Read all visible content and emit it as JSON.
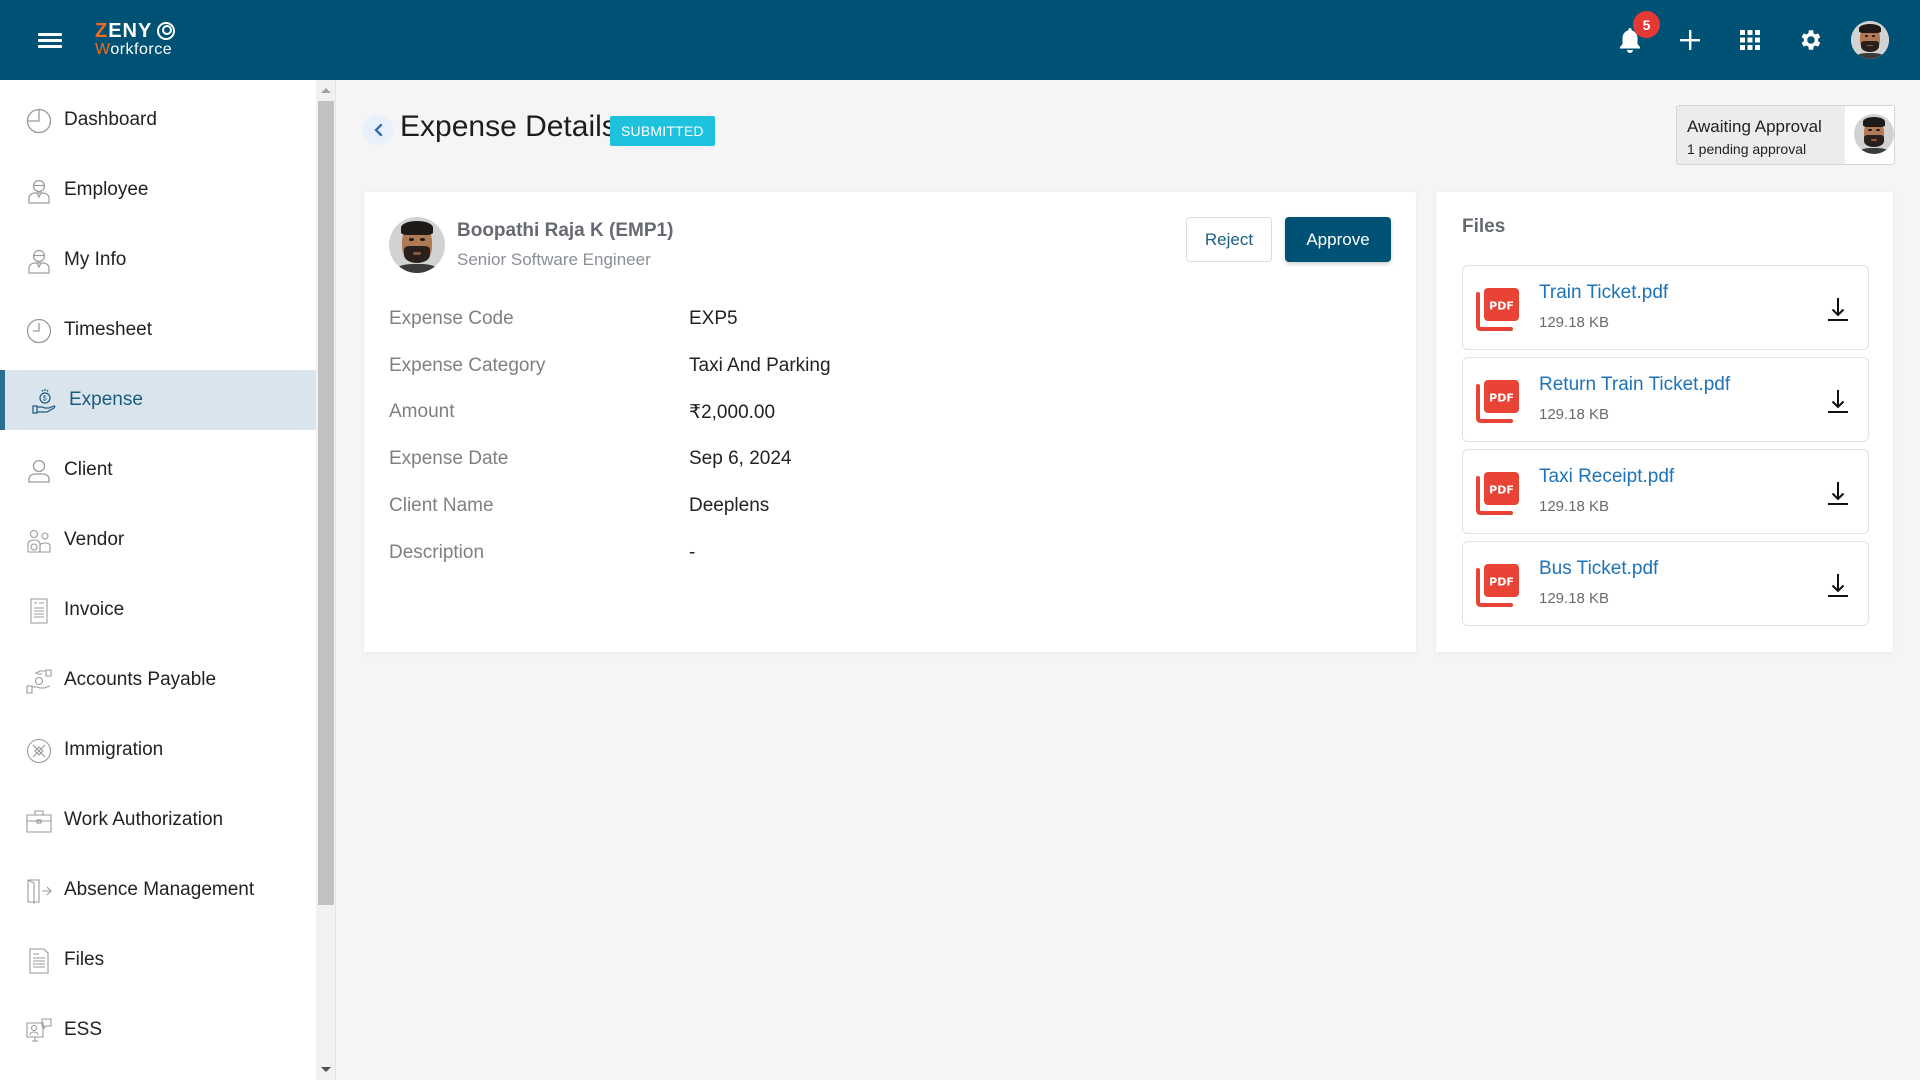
{
  "header": {
    "logo_line1_accent": "Z",
    "logo_line1_rest": "ENY",
    "logo_line2_accent": "W",
    "logo_line2_rest": "orkforce",
    "notification_count": "5",
    "icons": [
      "menu-icon",
      "bell-icon",
      "plus-icon",
      "apps-grid-icon",
      "gear-icon",
      "user-avatar"
    ]
  },
  "sidebar": {
    "items": [
      {
        "label": "Dashboard",
        "icon": "dashboard-pie-icon",
        "active": false
      },
      {
        "label": "Employee",
        "icon": "employee-icon",
        "active": false
      },
      {
        "label": "My Info",
        "icon": "my-info-icon",
        "active": false
      },
      {
        "label": "Timesheet",
        "icon": "clock-icon",
        "active": false
      },
      {
        "label": "Expense",
        "icon": "money-hand-icon",
        "active": true
      },
      {
        "label": "Client",
        "icon": "client-user-icon",
        "active": false
      },
      {
        "label": "Vendor",
        "icon": "vendor-icon",
        "active": false
      },
      {
        "label": "Invoice",
        "icon": "invoice-icon",
        "active": false
      },
      {
        "label": "Accounts Payable",
        "icon": "accounts-payable-icon",
        "active": false
      },
      {
        "label": "Immigration",
        "icon": "plane-icon",
        "active": false
      },
      {
        "label": "Work Authorization",
        "icon": "briefcase-icon",
        "active": false
      },
      {
        "label": "Absence Management",
        "icon": "door-exit-icon",
        "active": false
      },
      {
        "label": "Files",
        "icon": "document-icon",
        "active": false
      },
      {
        "label": "ESS",
        "icon": "monitor-chat-icon",
        "active": false
      }
    ]
  },
  "page": {
    "title": "Expense Details",
    "status": "SUBMITTED",
    "awaiting": {
      "title": "Awaiting Approval",
      "subtitle": "1 pending approval"
    }
  },
  "employee": {
    "name": "Boopathi Raja K (EMP1)",
    "role": "Senior Software Engineer"
  },
  "actions": {
    "reject": "Reject",
    "approve": "Approve"
  },
  "details": [
    {
      "label": "Expense Code",
      "value": "EXP5"
    },
    {
      "label": "Expense Category",
      "value": "Taxi And Parking"
    },
    {
      "label": "Amount",
      "value": "₹2,000.00"
    },
    {
      "label": "Expense Date",
      "value": "Sep 6, 2024"
    },
    {
      "label": "Client Name",
      "value": "Deeplens"
    },
    {
      "label": "Description",
      "value": "-"
    }
  ],
  "files": {
    "title": "Files",
    "items": [
      {
        "name": "Train Ticket.pdf",
        "size": "129.18 KB"
      },
      {
        "name": "Return Train Ticket.pdf",
        "size": "129.18 KB"
      },
      {
        "name": "Taxi Receipt.pdf",
        "size": "129.18 KB"
      },
      {
        "name": "Bus Ticket.pdf",
        "size": "129.18 KB"
      }
    ]
  },
  "colors": {
    "header_bg": "#005274",
    "accent_orange": "#f26b21",
    "active_sidebar_bg": "#d9e4ec",
    "status_badge": "#1ec2de",
    "approve_bg": "#005274",
    "file_link": "#1d72b8",
    "pdf_red": "#e84335",
    "notification_red": "#e53935"
  }
}
